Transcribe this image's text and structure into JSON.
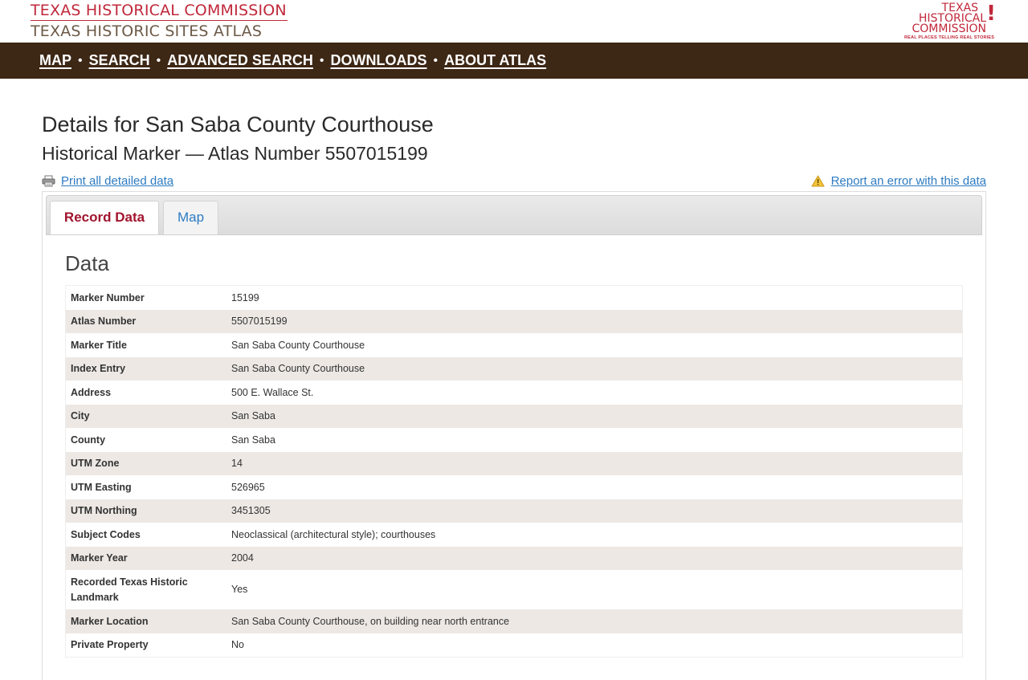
{
  "header": {
    "brand_line1": "TEXAS HISTORICAL COMMISSION",
    "brand_line2": "TEXAS HISTORIC SITES ATLAS",
    "logo": {
      "line1": "TEXAS",
      "line2": "HISTORICAL",
      "line3": "COMMISSION",
      "tagline": "REAL PLACES TELLING REAL STORIES"
    }
  },
  "nav": {
    "items": [
      {
        "label": "MAP"
      },
      {
        "label": "SEARCH"
      },
      {
        "label": "ADVANCED SEARCH"
      },
      {
        "label": "DOWNLOADS"
      },
      {
        "label": "ABOUT ATLAS"
      }
    ]
  },
  "page": {
    "title": "Details for San Saba County Courthouse",
    "subtitle": "Historical Marker — Atlas Number 5507015199",
    "print_link": "Print all detailed data",
    "report_link": "Report an error with this data"
  },
  "tabs": [
    {
      "label": "Record Data",
      "active": true
    },
    {
      "label": "Map",
      "active": false
    }
  ],
  "data_section": {
    "heading": "Data",
    "rows": [
      {
        "label": "Marker Number",
        "value": "15199"
      },
      {
        "label": "Atlas Number",
        "value": "5507015199"
      },
      {
        "label": "Marker Title",
        "value": "San Saba County Courthouse"
      },
      {
        "label": "Index Entry",
        "value": "San Saba County Courthouse"
      },
      {
        "label": "Address",
        "value": "500 E. Wallace St."
      },
      {
        "label": "City",
        "value": "San Saba"
      },
      {
        "label": "County",
        "value": "San Saba"
      },
      {
        "label": "UTM Zone",
        "value": "14"
      },
      {
        "label": "UTM Easting",
        "value": "526965"
      },
      {
        "label": "UTM Northing",
        "value": "3451305"
      },
      {
        "label": "Subject Codes",
        "value": "Neoclassical (architectural style); courthouses"
      },
      {
        "label": "Marker Year",
        "value": "2004"
      },
      {
        "label": "Recorded Texas Historic Landmark",
        "value": "Yes"
      },
      {
        "label": "Marker Location",
        "value": "San Saba County Courthouse, on building near north entrance"
      },
      {
        "label": "Private Property",
        "value": "No"
      }
    ]
  },
  "colors": {
    "brand_red": "#c0283a",
    "brand_brown": "#6d5a47",
    "nav_bg": "#3d2715",
    "link_blue": "#2d7bc1",
    "active_tab": "#a1142d",
    "row_alt": "#ede8e4"
  },
  "icons": {
    "print": "printer-icon",
    "report": "warning-triangle-icon"
  }
}
